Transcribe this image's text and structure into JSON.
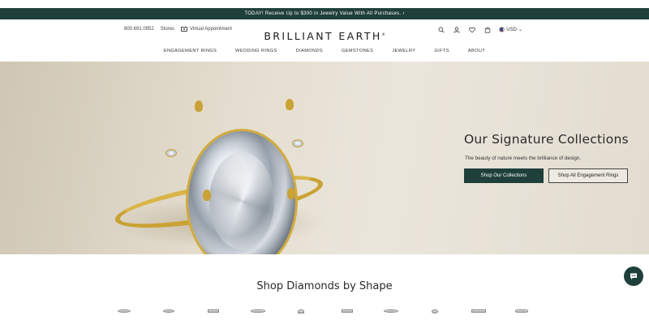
{
  "promo": {
    "text": "TODAY! Receive Up to $300 in Jewelry Value With All Purchases. ›"
  },
  "header": {
    "phone": "800.691.0952",
    "stores": "Stores",
    "virtual_appointment": "Virtual Appointment",
    "logo": "BRILLIANT EARTH",
    "logo_mark": "®",
    "currency": "USD"
  },
  "nav": {
    "items": [
      "ENGAGEMENT RINGS",
      "WEDDING RINGS",
      "DIAMONDS",
      "GEMSTONES",
      "JEWELRY",
      "GIFTS",
      "ABOUT"
    ]
  },
  "hero": {
    "title": "Our Signature Collections",
    "subtitle": "The beauty of nature meets the brilliance of design.",
    "primary_button": "Shop Our Collections",
    "secondary_button": "Shop All Engagement Rings"
  },
  "shapes_section": {
    "title": "Shop Diamonds by Shape"
  },
  "icons": {
    "search": "search-icon",
    "account": "user-icon",
    "wishlist": "heart-icon",
    "cart": "bag-icon",
    "chat": "chat-icon",
    "flag": "us-flag-icon"
  },
  "colors": {
    "brand_dark_green": "#1f3f3b",
    "gold": "#c9a233"
  }
}
